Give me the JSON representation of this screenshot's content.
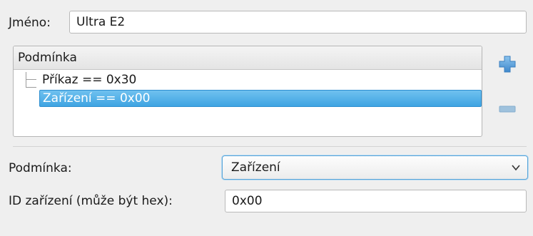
{
  "name_field": {
    "label": "Jméno:",
    "value": "Ultra E2"
  },
  "conditions_tree": {
    "header": "Podmínka",
    "items": [
      {
        "label": "Příkaz == 0x30",
        "selected": false
      },
      {
        "label": "Zařízení == 0x00",
        "selected": true
      }
    ],
    "add_icon": "plus-icon",
    "remove_icon": "minus-icon"
  },
  "condition_select": {
    "label": "Podmínka:",
    "value": "Zařízení"
  },
  "device_id_field": {
    "label": "ID zařízení (může být hex):",
    "value": "0x00"
  },
  "colors": {
    "selection": "#4aaee8",
    "accent_icon": "#5b9fd8",
    "background": "#efefef"
  }
}
